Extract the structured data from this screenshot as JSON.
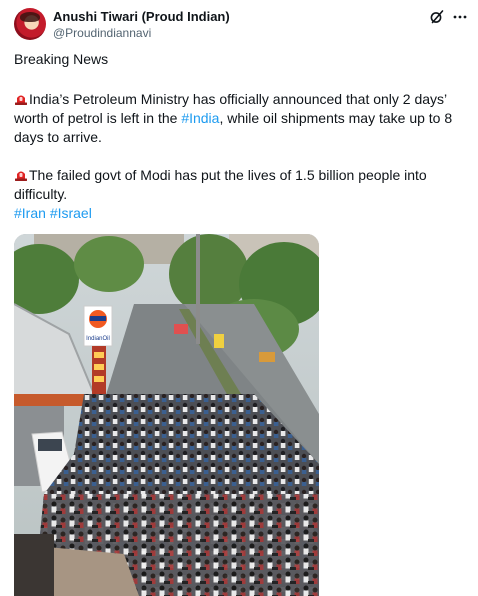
{
  "author": {
    "display_name": "Anushi Tiwari (Proud Indian)",
    "handle": "@Proudindiannavi"
  },
  "icons": {
    "grok": "grok-icon",
    "more": "more-options-icon",
    "siren": "police-light-emoji"
  },
  "tweet": {
    "headline": "Breaking News",
    "para1_line1_text": "India’s Petroleum Ministry has officially announced that only 2 days’",
    "para1_line2_pre": "worth of petrol is left in the ",
    "para1_line2_hashtag": "#India",
    "para1_line2_post": ",  while oil shipments may take up to 8",
    "para1_line3": "days to arrive.",
    "para2_line1_text": "The failed govt of  Modi has put the lives of 1.5 billion people into",
    "para2_line2": "difficulty.",
    "hashtag_iran": "#Iran",
    "hashtag_israel": "#Israel"
  },
  "photo_sign": {
    "brand": "IndianOil"
  },
  "colors": {
    "link": "#1d9bf0",
    "text": "#0f1419",
    "muted": "#536471",
    "brand_orange": "#f15a22"
  }
}
